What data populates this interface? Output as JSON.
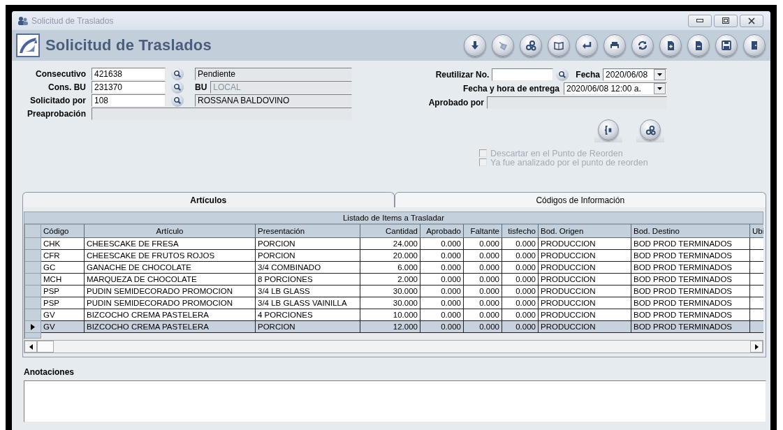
{
  "window": {
    "title": "Solicitud de Traslados"
  },
  "header": {
    "title": "Solicitud de Traslados"
  },
  "form_left": [
    {
      "kind": "lookup",
      "label": "Consecutivo",
      "value": "421638",
      "detail": "Pendiente",
      "detail_disabled": false
    },
    {
      "kind": "lookup",
      "label": "Cons. BU",
      "value": "231370",
      "detail_label": "BU",
      "detail": "LOCAL",
      "detail_disabled": true
    },
    {
      "kind": "lookup",
      "label": "Solicitado por",
      "value": "108",
      "detail": "ROSSANA BALDOVINO",
      "detail_disabled": false
    },
    {
      "kind": "plain",
      "label": "Preaprobación"
    }
  ],
  "form_right": {
    "reuse_label": "Reutilizar No.",
    "date_label": "Fecha",
    "date": "2020/06/08",
    "delivery_label": "Fecha y hora de entrega",
    "delivery": "2020/06/08 12:00 a.",
    "approved_label": "Aprobado por"
  },
  "options": [
    {
      "label": "Descartar en el Punto de Reorden",
      "checked": false,
      "disabled": true
    },
    {
      "label": "Ya fue analizado por el punto de reorden",
      "checked": false,
      "disabled": true
    }
  ],
  "tabs": [
    {
      "label": "Artículos",
      "selected": true
    },
    {
      "label": "Códigos de Información",
      "selected": false
    }
  ],
  "table": {
    "caption": "Listado de Items a Trasladar",
    "columns": [
      "Código",
      "Artículo",
      "Presentación",
      "Cantidad",
      "Aprobado",
      "Faltante",
      "tisfecho",
      "Bod. Origen",
      "Bod. Destino",
      "Ubi"
    ],
    "rows": [
      {
        "selected": false,
        "cells": [
          "CHK",
          "CHEESCAKE DE FRESA",
          "PORCION",
          "24.000",
          "0.000",
          "0.000",
          "0.000",
          "PRODUCCION",
          "BOD PROD TERMINADOS"
        ]
      },
      {
        "selected": false,
        "cells": [
          "CFR",
          "CHEESCAKE DE FRUTOS ROJOS",
          "PORCION",
          "20.000",
          "0.000",
          "0.000",
          "0.000",
          "PRODUCCION",
          "BOD PROD TERMINADOS"
        ]
      },
      {
        "selected": false,
        "cells": [
          "GC",
          "GANACHE DE CHOCOLATE",
          "3/4 COMBINADO",
          "6.000",
          "0.000",
          "0.000",
          "0.000",
          "PRODUCCION",
          "BOD PROD TERMINADOS"
        ]
      },
      {
        "selected": false,
        "cells": [
          "MCH",
          "MARQUEZA DE CHOCOLATE",
          "8 PORCIONES",
          "2.000",
          "0.000",
          "0.000",
          "0.000",
          "PRODUCCION",
          "BOD PROD TERMINADOS"
        ]
      },
      {
        "selected": false,
        "cells": [
          "PSP",
          "PUDIN SEMIDECORADO PROMOCION",
          "3/4 LB GLASS",
          "30.000",
          "0.000",
          "0.000",
          "0.000",
          "PRODUCCION",
          "BOD PROD TERMINADOS"
        ]
      },
      {
        "selected": false,
        "cells": [
          "PSP",
          "PUDIN SEMIDECORADO PROMOCION",
          "3/4 LB GLASS VAINILLA",
          "30.000",
          "0.000",
          "0.000",
          "0.000",
          "PRODUCCION",
          "BOD PROD TERMINADOS"
        ]
      },
      {
        "selected": false,
        "cells": [
          "GV",
          "BIZCOCHO CREMA PASTELERA",
          "4 PORCIONES",
          "10.000",
          "0.000",
          "0.000",
          "0.000",
          "PRODUCCION",
          "BOD PROD TERMINADOS"
        ]
      },
      {
        "selected": true,
        "cells": [
          "GV",
          "BIZCOCHO CREMA PASTELERA",
          "PORCION",
          "12.000",
          "0.000",
          "0.000",
          "0.000",
          "PRODUCCION",
          "BOD PROD TERMINADOS"
        ]
      }
    ]
  },
  "notes": {
    "label": "Anotaciones"
  }
}
